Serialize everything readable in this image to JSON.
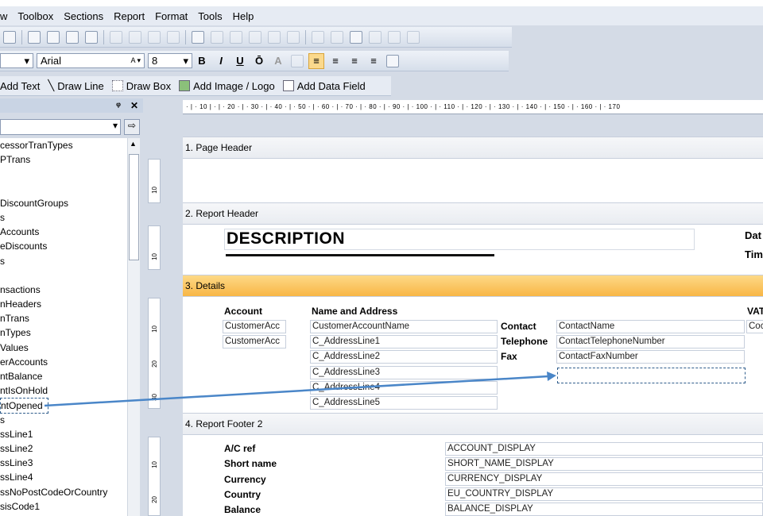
{
  "menu": [
    "w",
    "Toolbox",
    "Sections",
    "Report",
    "Format",
    "Tools",
    "Help"
  ],
  "format": {
    "font": "Arial",
    "size": "8",
    "bold": "B",
    "italic": "I",
    "underline": "U",
    "over": "Ō",
    "font_size_icon": "A"
  },
  "draw": {
    "add_text": "Add Text",
    "draw_line": "Draw Line",
    "draw_box": "Draw Box",
    "add_image": "Add Image / Logo",
    "add_field": "Add Data Field"
  },
  "panel": {
    "pin": "X",
    "close": "✕"
  },
  "tree_items": [
    "cessorTranTypes",
    "PTrans",
    "",
    "",
    "DiscountGroups",
    "s",
    "Accounts",
    "eDiscounts",
    "s",
    "",
    "nsactions",
    "nHeaders",
    "nTrans",
    "nTypes",
    "Values",
    "erAccounts",
    "ntBalance",
    "ntIsOnHold",
    "ntOpened",
    "s",
    "ssLine1",
    "ssLine2",
    "ssLine3",
    "ssLine4",
    "ssNoPostCodeOrCountry",
    "sisCode1"
  ],
  "ruler": "· | · 10 | · | · 20 · | · 30 · | · 40 · | · 50 · | · 60 · | · 70 · | · 80 · | · 90 · | · 100 · | · 110 · | · 120 · | · 130 · | · 140 · | · 150 · | · 160 · | · 170",
  "ruler_marks": {
    "a": "10",
    "b": "10",
    "c": "10",
    "d": "20",
    "e": "30",
    "f": "10",
    "g": "20"
  },
  "sections": {
    "page_header": "1. Page Header",
    "report_header": "2. Report Header",
    "details": "3. Details",
    "footer": "4. Report Footer 2"
  },
  "report_header": {
    "description": "DESCRIPTION",
    "date": "Dat",
    "time": "Tim"
  },
  "details": {
    "account_lbl": "Account",
    "name_lbl": "Name and Address",
    "vat_lbl": "VAT",
    "acc1": "CustomerAcc",
    "acc2": "CustomerAcc",
    "name": "CustomerAccountName",
    "addr1": "C_AddressLine1",
    "addr2": "C_AddressLine2",
    "addr3": "C_AddressLine3",
    "addr4": "C_AddressLine4",
    "addr5": "C_AddressLine5",
    "contact_lbl": "Contact",
    "tel_lbl": "Telephone",
    "fax_lbl": "Fax",
    "contact": "ContactName",
    "tel": "ContactTelephoneNumber",
    "fax": "ContactFaxNumber",
    "vat": "Coc"
  },
  "footer": {
    "labels": [
      "A/C ref",
      "Short name",
      "Currency",
      "Country",
      "Balance"
    ],
    "values": [
      "ACCOUNT_DISPLAY",
      "SHORT_NAME_DISPLAY",
      "CURRENCY_DISPLAY",
      "EU_COUNTRY_DISPLAY",
      "BALANCE_DISPLAY"
    ]
  }
}
